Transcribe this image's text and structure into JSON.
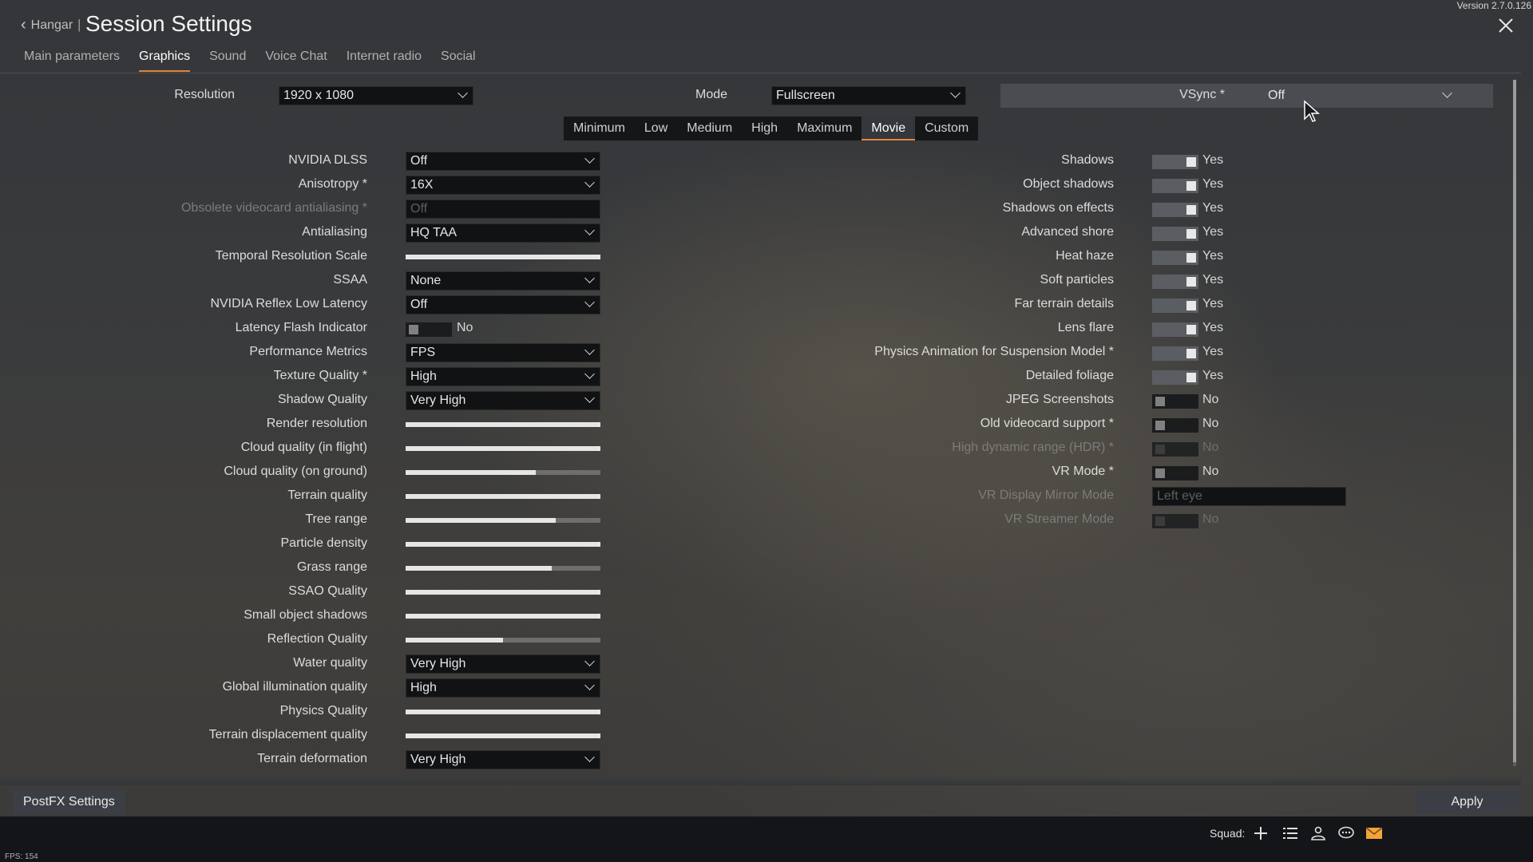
{
  "header": {
    "back_label": "Hangar",
    "separator": "|",
    "title": "Session Settings",
    "version": "Version 2.7.0.126"
  },
  "tabs": [
    "Main parameters",
    "Graphics",
    "Sound",
    "Voice Chat",
    "Internet radio",
    "Social"
  ],
  "top_row": {
    "resolution_label": "Resolution",
    "resolution_value": "1920 x 1080",
    "mode_label": "Mode",
    "mode_value": "Fullscreen",
    "vsync_label": "VSync *",
    "vsync_value": "Off"
  },
  "presets": [
    "Minimum",
    "Low",
    "Medium",
    "High",
    "Maximum",
    "Movie",
    "Custom"
  ],
  "active_preset": "Movie",
  "left_settings": [
    {
      "label": "NVIDIA DLSS",
      "type": "dropdown",
      "value": "Off"
    },
    {
      "label": "Anisotropy *",
      "type": "dropdown",
      "value": "16X"
    },
    {
      "label": "Obsolete videocard antialiasing *",
      "type": "dropdown-disabled",
      "value": "Off"
    },
    {
      "label": "Antialiasing",
      "type": "dropdown",
      "value": "HQ TAA"
    },
    {
      "label": "Temporal Resolution Scale",
      "type": "slider",
      "level": 1.0
    },
    {
      "label": "SSAA",
      "type": "dropdown",
      "value": "None"
    },
    {
      "label": "NVIDIA Reflex Low Latency",
      "type": "dropdown",
      "value": "Off"
    },
    {
      "label": "Latency Flash Indicator",
      "type": "toggle-off",
      "value": "No"
    },
    {
      "label": "Performance Metrics",
      "type": "dropdown",
      "value": "FPS"
    },
    {
      "label": "Texture Quality *",
      "type": "dropdown",
      "value": "High"
    },
    {
      "label": "Shadow Quality",
      "type": "dropdown",
      "value": "Very High"
    },
    {
      "label": "Render resolution",
      "type": "slider",
      "level": 1.0
    },
    {
      "label": "Cloud quality (in flight)",
      "type": "slider",
      "level": 1.0
    },
    {
      "label": "Cloud quality (on ground)",
      "type": "slider",
      "level": 0.67
    },
    {
      "label": "Terrain quality",
      "type": "slider",
      "level": 1.0
    },
    {
      "label": "Tree range",
      "type": "slider",
      "level": 0.77
    },
    {
      "label": "Particle density",
      "type": "slider",
      "level": 1.0
    },
    {
      "label": "Grass range",
      "type": "slider",
      "level": 0.75
    },
    {
      "label": "SSAO Quality",
      "type": "slider",
      "level": 1.0
    },
    {
      "label": "Small object shadows",
      "type": "slider",
      "level": 1.0
    },
    {
      "label": "Reflection Quality",
      "type": "slider",
      "level": 0.5
    },
    {
      "label": "Water quality",
      "type": "dropdown",
      "value": "Very High"
    },
    {
      "label": "Global illumination quality",
      "type": "dropdown",
      "value": "High"
    },
    {
      "label": "Physics Quality",
      "type": "slider",
      "level": 1.0
    },
    {
      "label": "Terrain displacement quality",
      "type": "slider",
      "level": 1.0
    },
    {
      "label": "Terrain deformation",
      "type": "dropdown",
      "value": "Very High"
    }
  ],
  "right_settings": [
    {
      "label": "Shadows",
      "type": "on",
      "value": "Yes"
    },
    {
      "label": "Object shadows",
      "type": "on",
      "value": "Yes"
    },
    {
      "label": "Shadows on effects",
      "type": "on",
      "value": "Yes"
    },
    {
      "label": "Advanced shore",
      "type": "on",
      "value": "Yes"
    },
    {
      "label": "Heat haze",
      "type": "on",
      "value": "Yes"
    },
    {
      "label": "Soft particles",
      "type": "on",
      "value": "Yes"
    },
    {
      "label": "Far terrain details",
      "type": "on",
      "value": "Yes"
    },
    {
      "label": "Lens flare",
      "type": "on",
      "value": "Yes"
    },
    {
      "label": "Physics Animation for Suspension Model *",
      "type": "on",
      "value": "Yes"
    },
    {
      "label": "Detailed foliage",
      "type": "on",
      "value": "Yes"
    },
    {
      "label": "JPEG Screenshots",
      "type": "off",
      "value": "No"
    },
    {
      "label": "Old videocard support *",
      "type": "off",
      "value": "No"
    },
    {
      "label": "High dynamic range (HDR) *",
      "type": "disabled",
      "value": "No"
    },
    {
      "label": "VR Mode *",
      "type": "off",
      "value": "No"
    },
    {
      "label": "VR Display Mirror Mode",
      "type": "dropdown-disabled",
      "value": "Left eye"
    },
    {
      "label": "VR Streamer Mode",
      "type": "disabled",
      "value": "No"
    }
  ],
  "bottom": {
    "postfx_label": "PostFX Settings",
    "apply_label": "Apply"
  },
  "footer": {
    "squad_label": "Squad:",
    "icons": [
      "add-squad-icon",
      "list-icon",
      "contacts-icon",
      "chat-icon",
      "mail-icon"
    ],
    "fps": "FPS: 154"
  },
  "colors": {
    "accent": "#e4843a",
    "mail_icon": "#f2a33a"
  }
}
